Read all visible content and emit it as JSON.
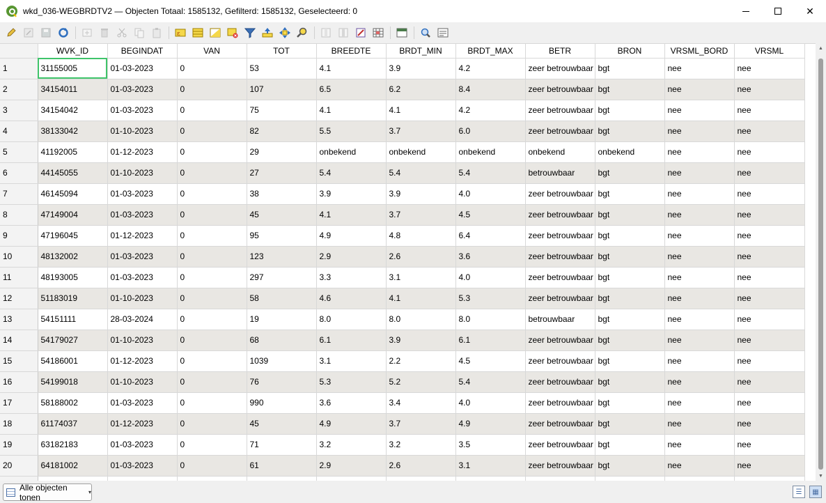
{
  "window": {
    "title": "wkd_036-WEGBRDTV2 — Objecten Totaal: 1585132, Gefilterd: 1585132, Geselecteerd: 0",
    "minimize": "—",
    "maximize": "☐",
    "close": "✕"
  },
  "toolbar": {
    "icons": [
      "toggle-editing-icon",
      "multi-edit-icon",
      "save-edits-icon",
      "reload-icon",
      "add-feature-icon",
      "delete-feature-icon",
      "cut-icon",
      "copy-icon",
      "paste-icon",
      "expression-select-icon",
      "select-all-icon",
      "invert-selection-icon",
      "deselect-all-icon",
      "filter-selection-icon",
      "move-selection-top-icon",
      "pan-to-selection-icon",
      "zoom-to-selection-icon",
      "new-field-icon",
      "delete-field-icon",
      "field-calculator-icon",
      "conditional-format-icon",
      "dock-icon",
      "actions-icon",
      "form-view-icon"
    ]
  },
  "table": {
    "columns": [
      "WVK_ID",
      "BEGINDAT",
      "VAN",
      "TOT",
      "BREEDTE",
      "BRDT_MIN",
      "BRDT_MAX",
      "BETR",
      "BRON",
      "VRSML_BORD",
      "VRSML"
    ],
    "rows": [
      [
        "1",
        "31155005",
        "01-03-2023",
        "0",
        "53",
        "4.1",
        "3.9",
        "4.2",
        "zeer betrouwbaar",
        "bgt",
        "nee",
        "nee"
      ],
      [
        "2",
        "34154011",
        "01-03-2023",
        "0",
        "107",
        "6.5",
        "6.2",
        "8.4",
        "zeer betrouwbaar",
        "bgt",
        "nee",
        "nee"
      ],
      [
        "3",
        "34154042",
        "01-03-2023",
        "0",
        "75",
        "4.1",
        "4.1",
        "4.2",
        "zeer betrouwbaar",
        "bgt",
        "nee",
        "nee"
      ],
      [
        "4",
        "38133042",
        "01-10-2023",
        "0",
        "82",
        "5.5",
        "3.7",
        "6.0",
        "zeer betrouwbaar",
        "bgt",
        "nee",
        "nee"
      ],
      [
        "5",
        "41192005",
        "01-12-2023",
        "0",
        "29",
        "onbekend",
        "onbekend",
        "onbekend",
        "onbekend",
        "onbekend",
        "nee",
        "nee"
      ],
      [
        "6",
        "44145055",
        "01-10-2023",
        "0",
        "27",
        "5.4",
        "5.4",
        "5.4",
        "betrouwbaar",
        "bgt",
        "nee",
        "nee"
      ],
      [
        "7",
        "46145094",
        "01-03-2023",
        "0",
        "38",
        "3.9",
        "3.9",
        "4.0",
        "zeer betrouwbaar",
        "bgt",
        "nee",
        "nee"
      ],
      [
        "8",
        "47149004",
        "01-03-2023",
        "0",
        "45",
        "4.1",
        "3.7",
        "4.5",
        "zeer betrouwbaar",
        "bgt",
        "nee",
        "nee"
      ],
      [
        "9",
        "47196045",
        "01-12-2023",
        "0",
        "95",
        "4.9",
        "4.8",
        "6.4",
        "zeer betrouwbaar",
        "bgt",
        "nee",
        "nee"
      ],
      [
        "10",
        "48132002",
        "01-03-2023",
        "0",
        "123",
        "2.9",
        "2.6",
        "3.6",
        "zeer betrouwbaar",
        "bgt",
        "nee",
        "nee"
      ],
      [
        "11",
        "48193005",
        "01-03-2023",
        "0",
        "297",
        "3.3",
        "3.1",
        "4.0",
        "zeer betrouwbaar",
        "bgt",
        "nee",
        "nee"
      ],
      [
        "12",
        "51183019",
        "01-10-2023",
        "0",
        "58",
        "4.6",
        "4.1",
        "5.3",
        "zeer betrouwbaar",
        "bgt",
        "nee",
        "nee"
      ],
      [
        "13",
        "54151111",
        "28-03-2024",
        "0",
        "19",
        "8.0",
        "8.0",
        "8.0",
        "betrouwbaar",
        "bgt",
        "nee",
        "nee"
      ],
      [
        "14",
        "54179027",
        "01-10-2023",
        "0",
        "68",
        "6.1",
        "3.9",
        "6.1",
        "zeer betrouwbaar",
        "bgt",
        "nee",
        "nee"
      ],
      [
        "15",
        "54186001",
        "01-12-2023",
        "0",
        "1039",
        "3.1",
        "2.2",
        "4.5",
        "zeer betrouwbaar",
        "bgt",
        "nee",
        "nee"
      ],
      [
        "16",
        "54199018",
        "01-10-2023",
        "0",
        "76",
        "5.3",
        "5.2",
        "5.4",
        "zeer betrouwbaar",
        "bgt",
        "nee",
        "nee"
      ],
      [
        "17",
        "58188002",
        "01-03-2023",
        "0",
        "990",
        "3.6",
        "3.4",
        "4.0",
        "zeer betrouwbaar",
        "bgt",
        "nee",
        "nee"
      ],
      [
        "18",
        "61174037",
        "01-12-2023",
        "0",
        "45",
        "4.9",
        "3.7",
        "4.9",
        "zeer betrouwbaar",
        "bgt",
        "nee",
        "nee"
      ],
      [
        "19",
        "63182183",
        "01-03-2023",
        "0",
        "71",
        "3.2",
        "3.2",
        "3.5",
        "zeer betrouwbaar",
        "bgt",
        "nee",
        "nee"
      ],
      [
        "20",
        "64181002",
        "01-03-2023",
        "0",
        "61",
        "2.9",
        "2.6",
        "3.1",
        "zeer betrouwbaar",
        "bgt",
        "nee",
        "nee"
      ],
      [
        "",
        "",
        "",
        "",
        "",
        "",
        "",
        "",
        "",
        "",
        "",
        ""
      ]
    ]
  },
  "statusbar": {
    "filter_label": "Alle objecten tonen",
    "dropdown_arrow": "▾"
  },
  "colors": {
    "alt_row": "#e9e7e3",
    "selected_cell_outline": "#3fc46a",
    "grid_line": "#d8d8d8"
  }
}
